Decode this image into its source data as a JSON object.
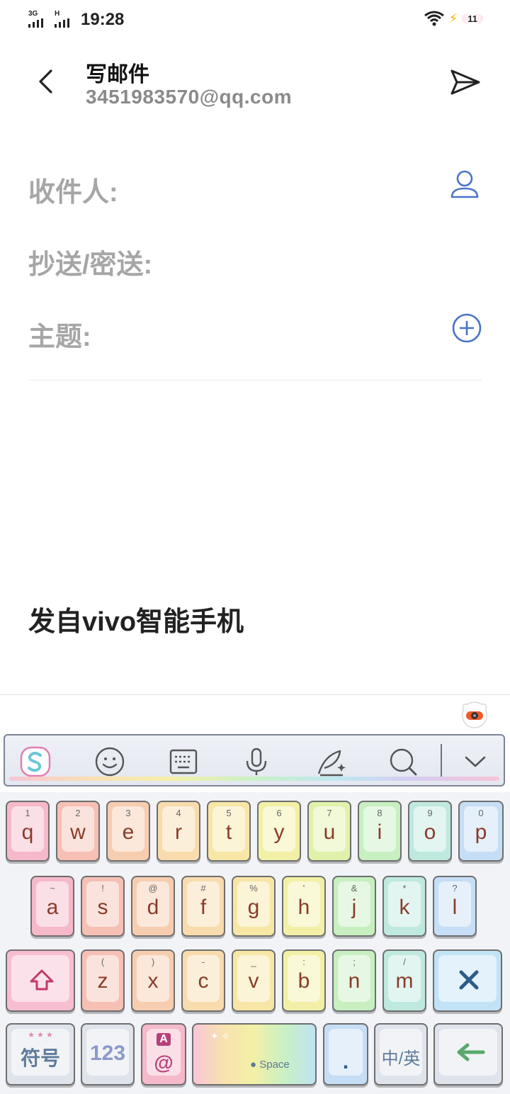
{
  "status_bar": {
    "network1": "3G",
    "network2": "H",
    "time": "19:28",
    "battery": "11"
  },
  "header": {
    "title": "写邮件",
    "account": "3451983570@qq.com"
  },
  "fields": {
    "to_label": "收件人:",
    "cc_label": "抄送/密送:",
    "subject_label": "主题:"
  },
  "body": {
    "signature": "发自vivo智能手机"
  },
  "keyboard": {
    "toolbar_icons": [
      "sogou-logo-icon",
      "emoji-icon",
      "keyboard-icon",
      "microphone-icon",
      "handwriting-icon",
      "search-icon",
      "collapse-chevron-icon"
    ],
    "row1": [
      {
        "alt": "1",
        "key": "q"
      },
      {
        "alt": "2",
        "key": "w"
      },
      {
        "alt": "3",
        "key": "e"
      },
      {
        "alt": "4",
        "key": "r"
      },
      {
        "alt": "5",
        "key": "t"
      },
      {
        "alt": "6",
        "key": "y"
      },
      {
        "alt": "7",
        "key": "u"
      },
      {
        "alt": "8",
        "key": "i"
      },
      {
        "alt": "9",
        "key": "o"
      },
      {
        "alt": "0",
        "key": "p"
      }
    ],
    "row2": [
      {
        "alt": "~",
        "key": "a"
      },
      {
        "alt": "!",
        "key": "s"
      },
      {
        "alt": "@",
        "key": "d"
      },
      {
        "alt": "#",
        "key": "f"
      },
      {
        "alt": "%",
        "key": "g"
      },
      {
        "alt": "'",
        "key": "h"
      },
      {
        "alt": "&",
        "key": "j"
      },
      {
        "alt": "*",
        "key": "k"
      },
      {
        "alt": "?",
        "key": "l"
      }
    ],
    "row3": [
      {
        "alt": "(",
        "key": "z"
      },
      {
        "alt": ")",
        "key": "x"
      },
      {
        "alt": "-",
        "key": "c"
      },
      {
        "alt": "_",
        "key": "v"
      },
      {
        "alt": ":",
        "key": "b"
      },
      {
        "alt": ";",
        "key": "n"
      },
      {
        "alt": "/",
        "key": "m"
      }
    ],
    "symbols_label": "符号",
    "numbers_label": "123",
    "at_top": "A",
    "at_label": "@",
    "space_label": "Space",
    "period_label": ".",
    "lang_label": "中/英",
    "colors": {
      "row": [
        "#f5b9c9",
        "#f6c0b4",
        "#f7cdb0",
        "#f8dcae",
        "#f7e6a6",
        "#f2f0a6",
        "#dff1ab",
        "#c7efc0",
        "#bfe9df",
        "#c6def5"
      ]
    }
  }
}
